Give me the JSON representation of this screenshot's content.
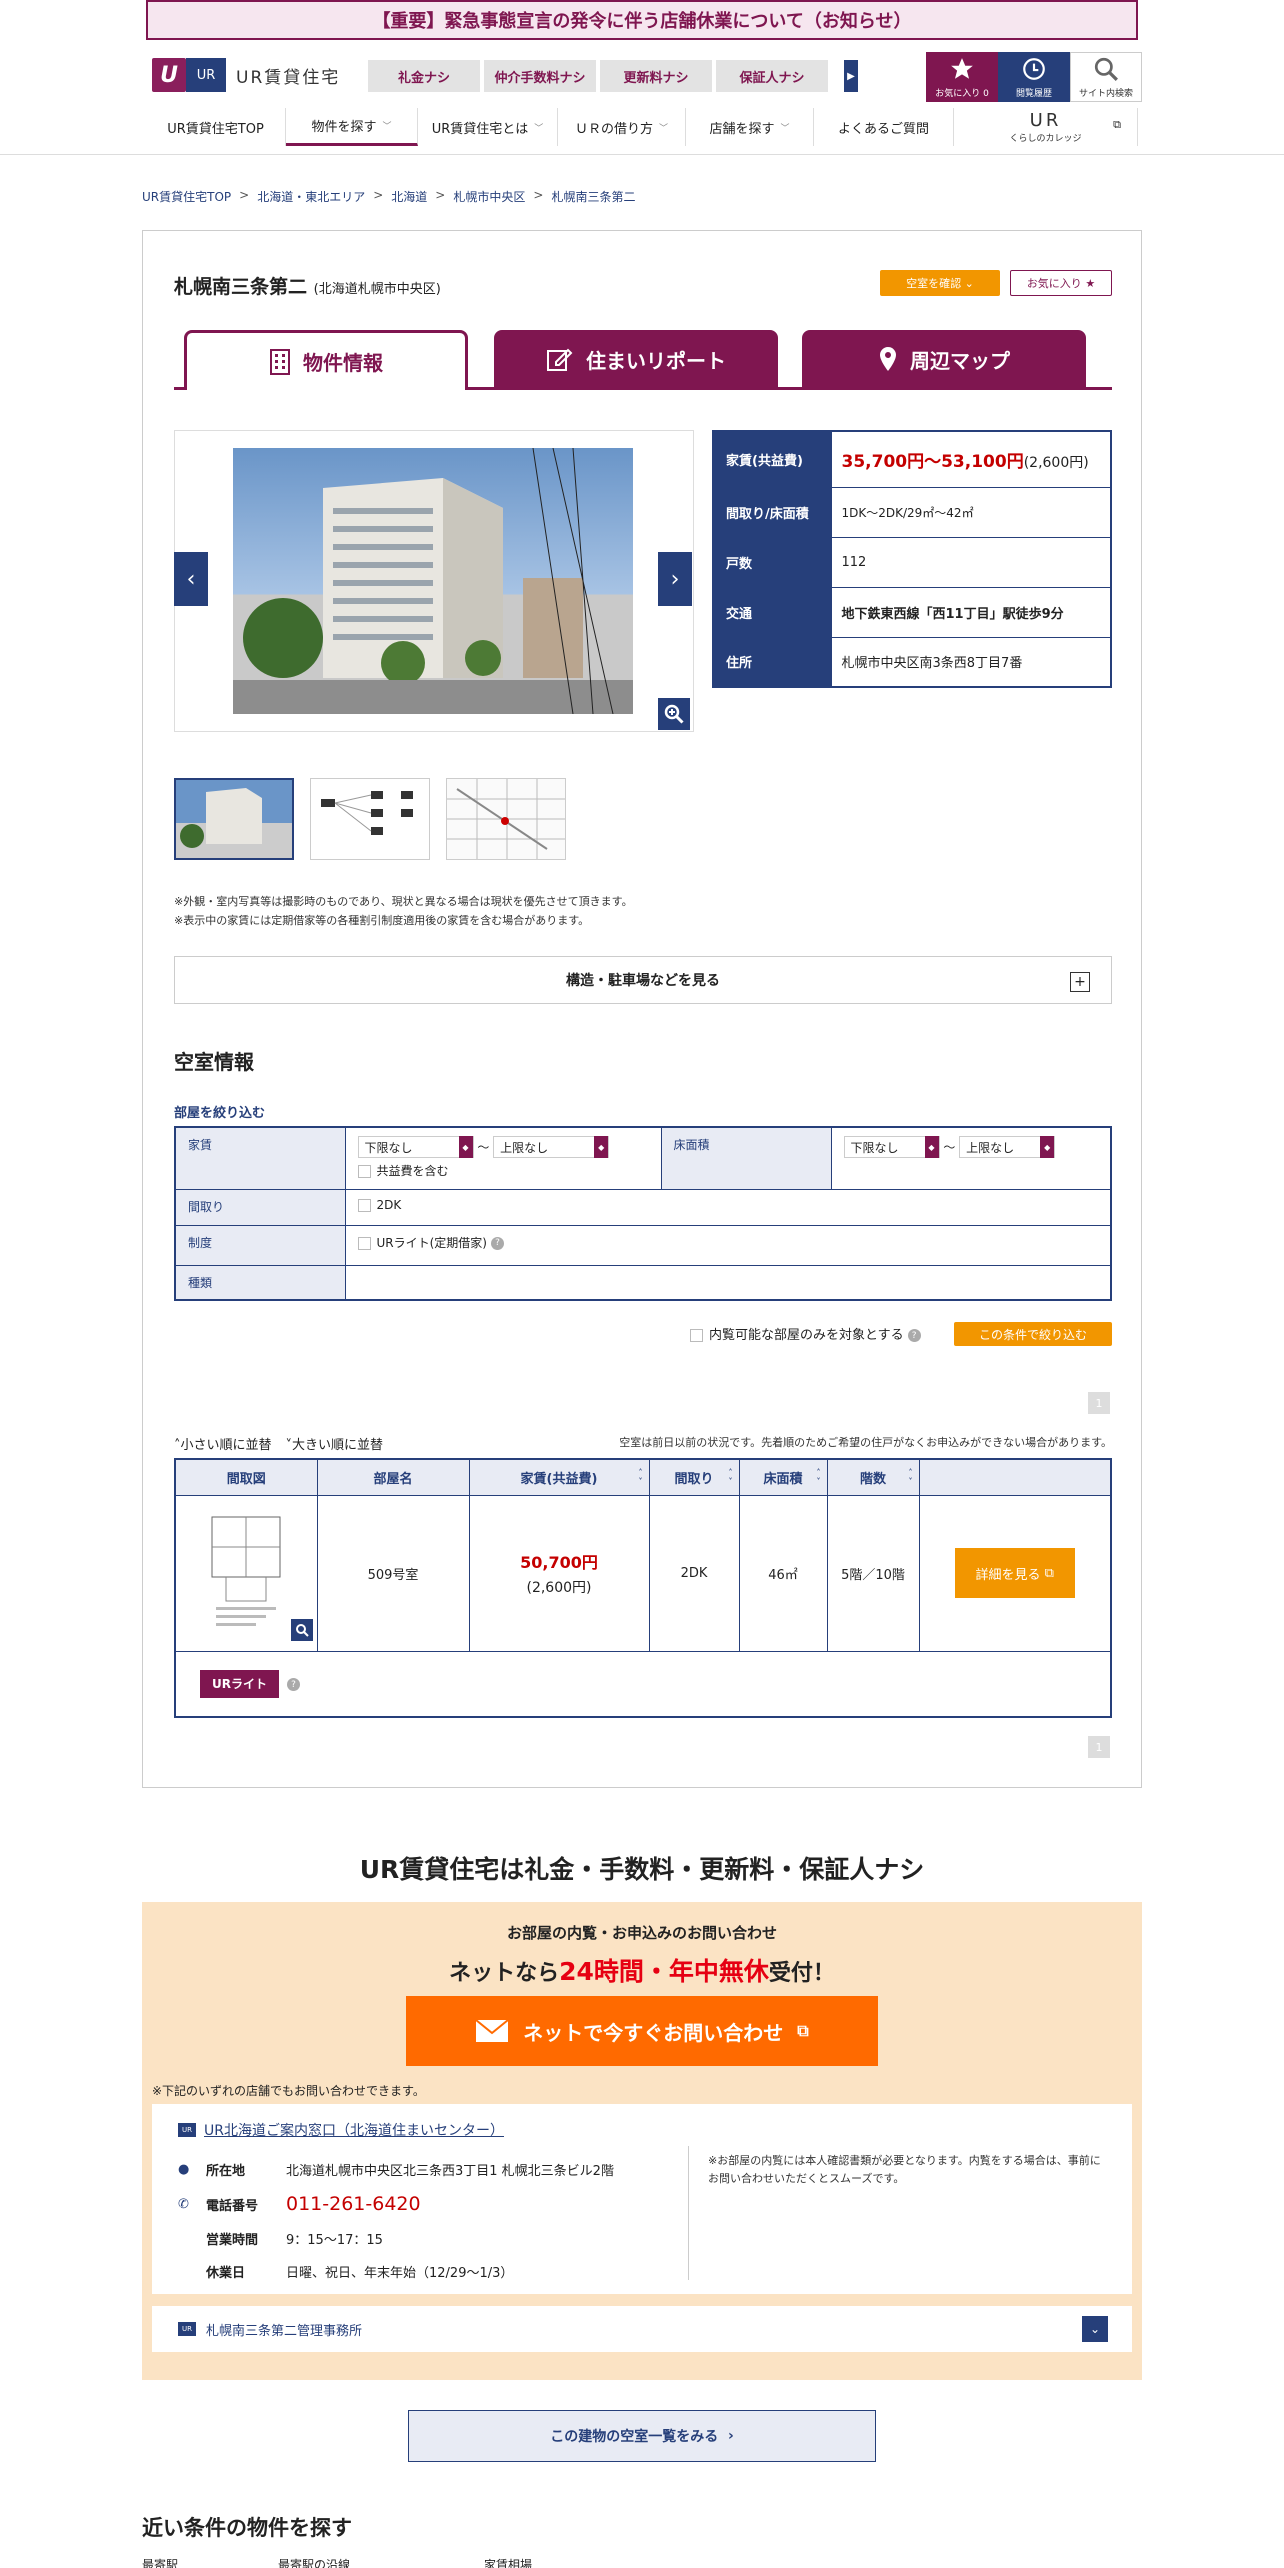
{
  "notice": "【重要】緊急事態宣言の発令に伴う店舗休業について（お知らせ）",
  "logo": {
    "mark": "U",
    "ur": "UR",
    "text": "UR賃貸住宅"
  },
  "nashi_tabs": [
    "礼金ナシ",
    "仲介手数料ナシ",
    "更新料ナシ",
    "保証人ナシ"
  ],
  "header_buttons": {
    "favorite": "お気に入り",
    "favorite_count": "0",
    "history": "閲覧履歴",
    "search": "サイト内検索"
  },
  "gnav": {
    "items": [
      "UR賃貸住宅TOP",
      "物件を探す",
      "UR賃貸住宅とは",
      "ＵＲの借り方",
      "店舗を探す",
      "よくあるご質問"
    ],
    "logo_big": "UR",
    "logo_small": "くらしのカレッジ"
  },
  "breadcrumb": [
    "UR賃貸住宅TOP",
    "北海道・東北エリア",
    "北海道",
    "札幌市中央区",
    "札幌南三条第二"
  ],
  "property": {
    "name": "札幌南三条第二",
    "area": "(北海道札幌市中央区)",
    "vacancy_button": "空室を確認",
    "favorite_button": "お気に入り"
  },
  "tabs": [
    "物件情報",
    "住まいリポート",
    "周辺マップ"
  ],
  "info": {
    "rent_label": "家賃(共益費)",
    "rent_value": "35,700円～53,100円",
    "rent_common": "(2,600円)",
    "layout_label": "間取り/床面積",
    "layout_value": "1DK～2DK/29㎡～42㎡",
    "units_label": "戸数",
    "units_value": "112",
    "access_label": "交通",
    "access_value": "地下鉄東西線「西11丁目」駅徒歩9分",
    "address_label": "住所",
    "address_value": "札幌市中央区南3条西8丁目7番"
  },
  "notes": [
    "※外観・室内写真等は撮影時のものであり、現状と異なる場合は現状を優先させて頂きます。",
    "※表示中の家賃には定期借家等の各種割引制度適用後の家賃を含む場合があります。"
  ],
  "accordion": "構造・駐車場などを見る",
  "vacancy": {
    "title": "空室情報",
    "filter_label": "部屋を絞り込む",
    "rent_label": "家賃",
    "floor_label": "床面積",
    "lower": "下限なし",
    "upper": "上限なし",
    "tilde": "～",
    "include_common": "共益費を含む",
    "madori_label": "間取り",
    "madori_option": "2DK",
    "seido_label": "制度",
    "seido_option": "URライト(定期借家)",
    "shurui_label": "種類",
    "viewable_only": "内覧可能な部屋のみを対象とする",
    "narrow_button": "この条件で絞り込む",
    "page": "1",
    "sort_small": "小さい順に並替",
    "sort_large": "大きい順に並替",
    "status_note": "空室は前日以前の状況です。先着順のためご希望の住戸がなくお申込みができない場合があります。"
  },
  "result": {
    "headers": [
      "間取図",
      "部屋名",
      "家賃(共益費)",
      "間取り",
      "床面積",
      "階数",
      ""
    ],
    "row": {
      "room": "509号室",
      "rent": "50,700円",
      "common": "(2,600円)",
      "madori": "2DK",
      "area": "46㎡",
      "floor": "5階／10階",
      "detail": "詳細を見る"
    },
    "badge": "URライト"
  },
  "slogan": "UR賃貸住宅は礼金・手数料・更新料・保証人ナシ",
  "inquiry": {
    "sub": "お部屋の内覧・お申込みのお問い合わせ",
    "main_pre": "ネットなら",
    "main_red": "24時間・年中無休",
    "main_post": "受付！",
    "net_button": "ネットで今すぐお問い合わせ",
    "store_note": "※下記のいずれの店舗でもお問い合わせできます。",
    "store_name": "UR北海道ご案内窓口（北海道住まいセンター）",
    "addr_label": "所在地",
    "addr_value": "北海道札幌市中央区北三条西3丁目1 札幌北三条ビル2階",
    "tel_label": "電話番号",
    "tel_value": "011-261-6420",
    "hours_label": "営業時間",
    "hours_value": "9：15～17：15",
    "holiday_label": "休業日",
    "holiday_value": "日曜、祝日、年末年始（12/29～1/3）",
    "side_note": "※お部屋の内覧には本人確認書類が必要となります。内覧をする場合は、事前にお問い合わせいただくとスムーズです。",
    "mgmt_name": "札幌南三条第二管理事務所"
  },
  "list_button": "この建物の空室一覧をみる",
  "near_title": "近い条件の物件を探す",
  "near_links": [
    "最寄駅",
    "最寄駅の沿線",
    "家賃相場"
  ],
  "colors": {
    "brand": "#7f1650",
    "navy": "#263f7a",
    "orange": "#f29600",
    "net_orange": "#ff6a00",
    "rent_red": "#c40000"
  }
}
